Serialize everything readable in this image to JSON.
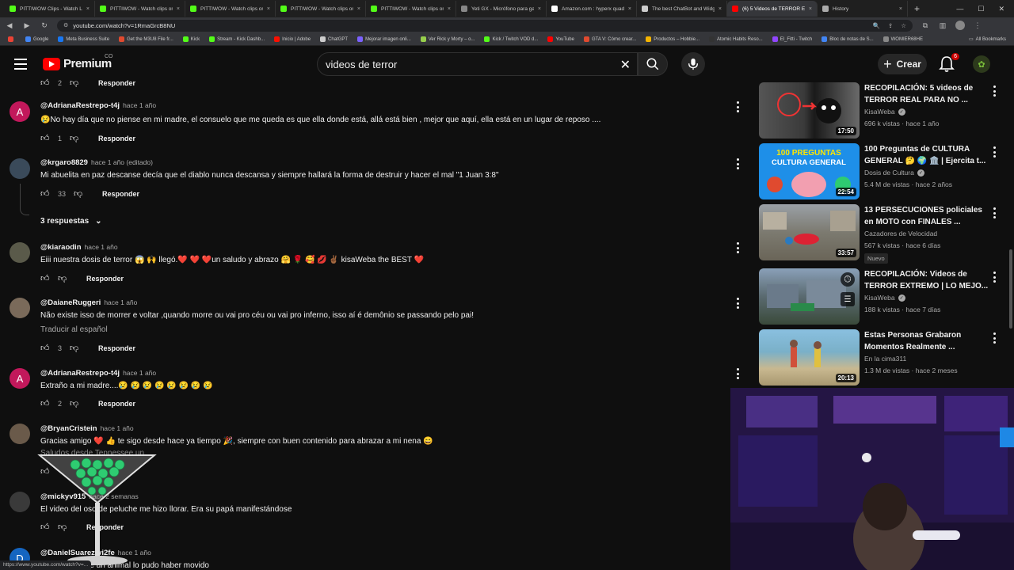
{
  "browser": {
    "tabs": [
      {
        "title": "PITTIWOW Clips - Watch Live",
        "color": "#53fc18"
      },
      {
        "title": "PITTIWOW - Watch clips on K",
        "color": "#53fc18"
      },
      {
        "title": "PITTIWOW - Watch clips on K",
        "color": "#53fc18"
      },
      {
        "title": "PITTIWOW - Watch clips on K",
        "color": "#53fc18"
      },
      {
        "title": "PITTIWOW - Watch clips on K",
        "color": "#53fc18"
      },
      {
        "title": "Yeti GX - Micrófono para gam",
        "color": "#888888"
      },
      {
        "title": "Amazon.com : hyperx quadca",
        "color": "#ffffff"
      },
      {
        "title": "The best ChatBot and Widget",
        "color": "#cccccc"
      },
      {
        "title": "(6) 5 Videos de TERROR EXTR",
        "color": "#ff0000",
        "active": true
      },
      {
        "title": "History",
        "color": "#aaaaaa"
      }
    ],
    "url": "youtube.com/watch?v=1RmaGrcB8NU",
    "bookmarks": [
      {
        "label": "",
        "color": "#ea4335"
      },
      {
        "label": "Google",
        "color": "#4285f4"
      },
      {
        "label": "Meta Business Suite",
        "color": "#1877f2"
      },
      {
        "label": "Get the M3U8 File fr...",
        "color": "#e04a2f"
      },
      {
        "label": "Kick",
        "color": "#53fc18"
      },
      {
        "label": "Stream - Kick Dashb...",
        "color": "#53fc18"
      },
      {
        "label": "Inicio | Adobe",
        "color": "#fa0f00"
      },
      {
        "label": "ChatGPT",
        "color": "#cccccc"
      },
      {
        "label": "Mejorar imagen onli...",
        "color": "#7b61ff"
      },
      {
        "label": "Ver Rick y Morty – o...",
        "color": "#97ce4c"
      },
      {
        "label": "Kick / Twitch VOD d...",
        "color": "#53fc18"
      },
      {
        "label": "YouTube",
        "color": "#ff0000"
      },
      {
        "label": "GTA V: Cómo crear...",
        "color": "#e04a2f"
      },
      {
        "label": "Productos – Hobbie...",
        "color": "#f4b400"
      },
      {
        "label": "Atomic Habits Reso...",
        "color": "#333333"
      },
      {
        "label": "El_Fitti - Twitch",
        "color": "#9146ff"
      },
      {
        "label": "Bloc de notas de S...",
        "color": "#4285f4"
      },
      {
        "label": "WOMIER68HE",
        "color": "#888888"
      }
    ],
    "all_bookmarks": "All Bookmarks",
    "status_url": "https://www.youtube.com/watch?v=..."
  },
  "header": {
    "logo_text": "Premium",
    "country": "CO",
    "search_value": "videos de terror",
    "create_label": "Crear",
    "notif_count": "6"
  },
  "comments": {
    "top_reply": {
      "likes": "2",
      "reply_label": "Responder"
    },
    "items": [
      {
        "handle": "@AdrianaRestrepo-t4j",
        "time": "hace 1 año",
        "text": "😢No hay día que no piense en mi madre, el consuelo que me queda es que  ella donde está,  allá está  bien , mejor que aquí,  ella está en un lugar de reposo ....",
        "likes": "1",
        "reply_label": "Responder",
        "avatar_letter": "A",
        "avatar_color": "#c2185b"
      },
      {
        "handle": "@krgaro8829",
        "time": "hace 1 año (editado)",
        "text": "Mi abuelita en paz descanse decía que el diablo nunca descansa y siempre hallará la forma de destruir y hacer el mal \"1 Juan 3:8\"",
        "likes": "33",
        "reply_label": "Responder",
        "avatar_letter": "",
        "avatar_color": "#3a4a5a",
        "replies": "3 respuestas"
      },
      {
        "handle": "@kiaraodin",
        "time": "hace 1 año",
        "text": "Eiii nuestra dosis de terror 😱 🙌 llegó.❤️ ❤️ ❤️un saludo y abrazo 🤗 🌹 🥰 💋 ✌🏾 kisaWeba the BEST ❤️",
        "likes": "",
        "reply_label": "Responder",
        "avatar_letter": "",
        "avatar_color": "#5a5a4a"
      },
      {
        "handle": "@DaianeRuggeri",
        "time": "hace 1 año",
        "text": "Não existe isso de morrer e voltar ,quando morre ou vai pro céu ou vai pro inferno, isso aí é demônio se passando pelo pai!",
        "translate": "Traducir al español",
        "likes": "3",
        "reply_label": "Responder",
        "avatar_letter": "",
        "avatar_color": "#7a6a5a"
      },
      {
        "handle": "@AdrianaRestrepo-t4j",
        "time": "hace 1 año",
        "text": "Extraño a mi madre....😢 😢 😢 😢 😢 😢 😢 😢",
        "likes": "2",
        "reply_label": "Responder",
        "avatar_letter": "A",
        "avatar_color": "#c2185b"
      },
      {
        "handle": "@BryanCristein",
        "time": "hace 1 año",
        "text": "Gracias amigo ❤️ 👍 te sigo desde hace ya tiempo 🎉, siempre con buen contenido para abrazar a mi nena 😄",
        "text2": "Saludos desde Tennessee un",
        "likes": "",
        "reply_label": "",
        "avatar_letter": "",
        "avatar_color": "#6a5a4a"
      },
      {
        "handle": "@mickyv915",
        "time": "hace 2 semanas",
        "text": "El video del oso de peluche me hizo llorar. Era su papá manifestándose",
        "likes": "",
        "reply_label": "Responder",
        "avatar_letter": "",
        "avatar_color": "#3a3a3a"
      },
      {
        "handle": "@DanielSuarez-vi2fe",
        "time": "hace 1 año",
        "text": "...e un animal lo pudo haber movido",
        "avatar_letter": "D",
        "avatar_color": "#1565c0"
      }
    ]
  },
  "sidebar": {
    "videos": [
      {
        "title": "RECOPILACIÓN: 5 videos de TERROR REAL PARA NO ...",
        "channel": "KisaWeba",
        "verified": true,
        "meta": "696 k vistas · hace 1 año",
        "duration": "17:50",
        "thumb_color": "#3a3a3a"
      },
      {
        "title": "100 Preguntas de CULTURA GENERAL 🤔 🌍 🏛️ | Ejercita t...",
        "channel": "Dosis de Cultura",
        "verified": true,
        "meta": "5.4 M de vistas · hace 2 años",
        "duration": "22:54",
        "thumb_color": "#1e90ff",
        "thumb_text": "100 PREGUNTAS CULTURA GENERAL"
      },
      {
        "title": "13 PERSECUCIONES policiales en MOTO con FINALES ...",
        "channel": "Cazadores de Velocidad",
        "verified": false,
        "meta": "567 k vistas · hace 6 días",
        "badge": "Nuevo",
        "duration": "33:57",
        "thumb_color": "#8a8a7a"
      },
      {
        "title": "RECOPILACIÓN: Videos de TERROR EXTREMO | LO MEJO...",
        "channel": "KisaWeba",
        "verified": true,
        "meta": "188 k vistas · hace 7 días",
        "duration": "",
        "thumb_color": "#5a6a7a"
      },
      {
        "title": "Estas Personas Grabaron Momentos Realmente ...",
        "channel": "En la cima311",
        "verified": false,
        "meta": "1.3 M de vistas · hace 2 meses",
        "duration": "20:13",
        "thumb_color": "#4a8a9a"
      }
    ]
  },
  "colors": {
    "bg": "#0f0f0f",
    "text": "#f1f1f1",
    "muted": "#aaaaaa",
    "accent": "#ff0000"
  }
}
